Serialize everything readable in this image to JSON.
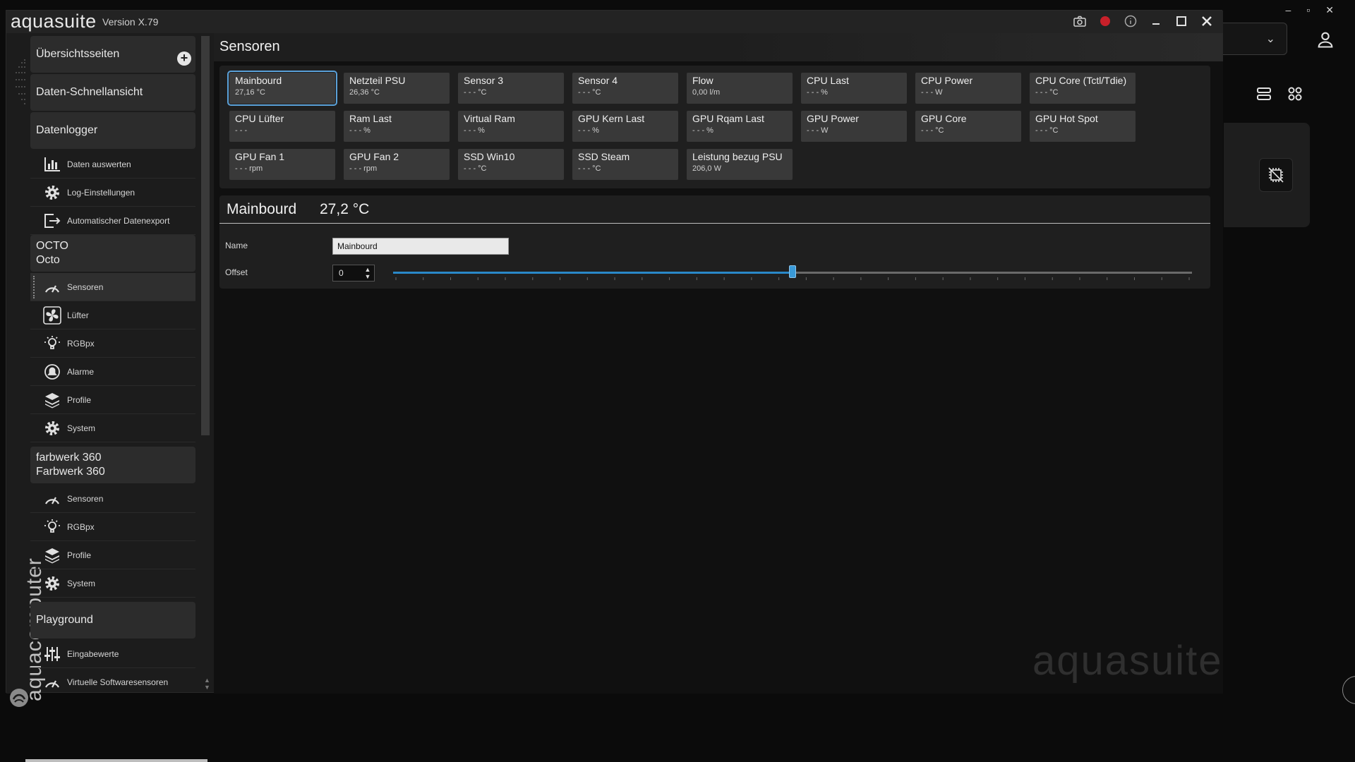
{
  "window": {
    "app_name": "aquasuite",
    "version": "Version X.79",
    "brand_vertical": "aquacomputer"
  },
  "titlebar_icons": [
    "camera-icon",
    "record-icon",
    "info-icon",
    "minimize-icon",
    "maximize-icon",
    "close-icon"
  ],
  "sidebar": {
    "sections": [
      {
        "label": "Übersichtsseiten"
      },
      {
        "label": "Daten-Schnellansicht"
      },
      {
        "label": "Datenlogger",
        "items": [
          {
            "label": "Daten auswerten",
            "icon": "bar-chart-icon"
          },
          {
            "label": "Log-Einstellungen",
            "icon": "gear-icon"
          },
          {
            "label": "Automatischer Datenexport",
            "icon": "export-icon"
          }
        ]
      },
      {
        "label": "OCTO",
        "sub": "Octo",
        "items": [
          {
            "label": "Sensoren",
            "icon": "gauge-icon",
            "active": true
          },
          {
            "label": "Lüfter",
            "icon": "fan-icon"
          },
          {
            "label": "RGBpx",
            "icon": "bulb-icon"
          },
          {
            "label": "Alarme",
            "icon": "alarm-icon"
          },
          {
            "label": "Profile",
            "icon": "layers-icon"
          },
          {
            "label": "System",
            "icon": "gear-icon"
          }
        ]
      },
      {
        "label": "farbwerk 360",
        "sub": "Farbwerk 360",
        "items": [
          {
            "label": "Sensoren",
            "icon": "gauge-icon"
          },
          {
            "label": "RGBpx",
            "icon": "bulb-icon"
          },
          {
            "label": "Profile",
            "icon": "layers-icon"
          },
          {
            "label": "System",
            "icon": "gear-icon"
          }
        ]
      },
      {
        "label": "Playground",
        "items": [
          {
            "label": "Eingabewerte",
            "icon": "sliders-icon"
          },
          {
            "label": "Virtuelle Softwaresensoren",
            "icon": "gauge-icon"
          }
        ]
      }
    ]
  },
  "content": {
    "title": "Sensoren",
    "tiles": [
      {
        "label": "Mainbourd",
        "value": "27,16 °C",
        "selected": true
      },
      {
        "label": "Netzteil PSU",
        "value": "26,36 °C"
      },
      {
        "label": "Sensor 3",
        "value": "- - - °C"
      },
      {
        "label": "Sensor 4",
        "value": "- - - °C"
      },
      {
        "label": "Flow",
        "value": "0,00 l/m"
      },
      {
        "label": "CPU Last",
        "value": "- - - %"
      },
      {
        "label": "CPU  Power",
        "value": "- - - W"
      },
      {
        "label": "CPU Core (Tctl/Tdie)",
        "value": "- - - °C"
      },
      {
        "label": "CPU Lüfter",
        "value": "- - -"
      },
      {
        "label": "Ram Last",
        "value": "- - - %"
      },
      {
        "label": "Virtual Ram",
        "value": "- - - %"
      },
      {
        "label": "GPU Kern Last",
        "value": "- - - %"
      },
      {
        "label": "GPU Rqam Last",
        "value": "- - - %"
      },
      {
        "label": "GPU Power",
        "value": "- - - W"
      },
      {
        "label": "GPU Core",
        "value": "- - - °C"
      },
      {
        "label": "GPU Hot Spot",
        "value": "- - - °C"
      },
      {
        "label": "GPU Fan 1",
        "value": "- - - rpm"
      },
      {
        "label": "GPU Fan 2",
        "value": "- - - rpm"
      },
      {
        "label": "SSD Win10",
        "value": "- - - °C"
      },
      {
        "label": "SSD Steam",
        "value": "- - - °C"
      },
      {
        "label": "Leistung bezug PSU",
        "value": "206,0 W"
      }
    ],
    "detail": {
      "name": "Mainbourd",
      "value": "27,2 °C",
      "name_label": "Name",
      "name_value": "Mainbourd",
      "offset_label": "Offset",
      "offset_value": "0",
      "offset_slider_fraction": 0.5
    },
    "watermark": "aquasuite"
  },
  "colors": {
    "accent": "#2a88c8",
    "selection": "#5aa0d8",
    "record": "#c8202a"
  }
}
